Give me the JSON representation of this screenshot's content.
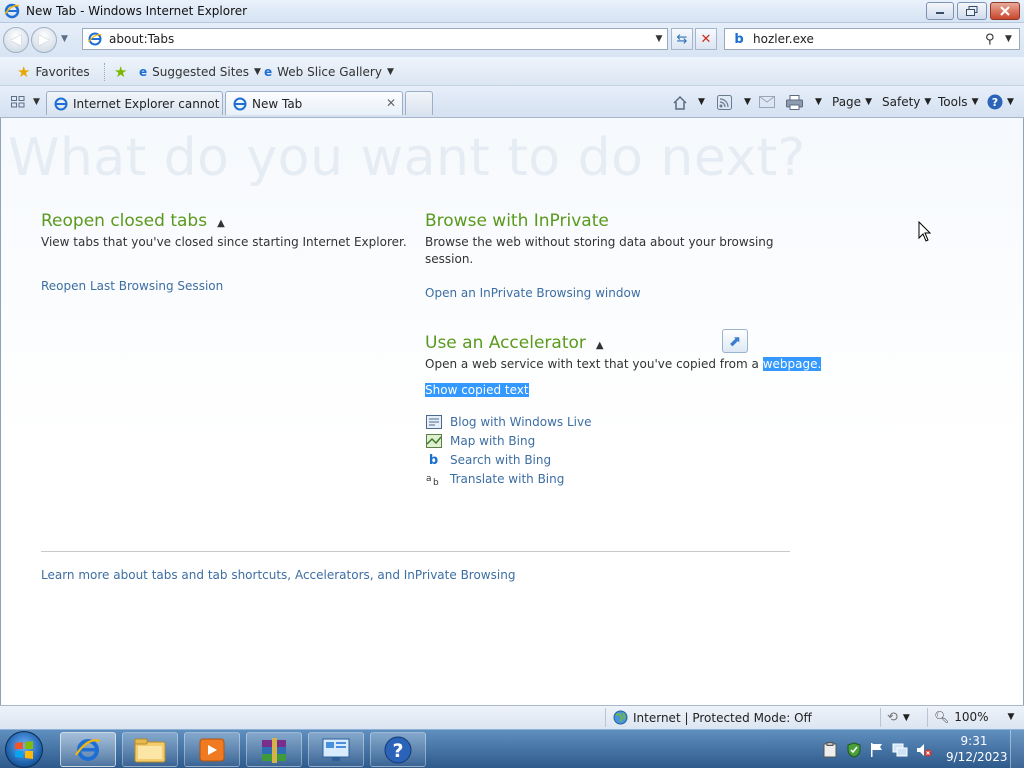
{
  "window": {
    "title": "New Tab - Windows Internet Explorer"
  },
  "address_bar": {
    "url": "about:Tabs"
  },
  "search_box": {
    "value": "hozler.exe"
  },
  "favorites_bar": {
    "favorites_label": "Favorites",
    "suggested_sites_label": "Suggested Sites",
    "web_slice_gallery_label": "Web Slice Gallery"
  },
  "tabs": [
    {
      "label": "Internet Explorer cannot di...",
      "active": false
    },
    {
      "label": "New Tab",
      "active": true
    }
  ],
  "command_bar": {
    "page_label": "Page",
    "safety_label": "Safety",
    "tools_label": "Tools"
  },
  "content": {
    "heading": "What do you want to do next?",
    "reopen": {
      "title": "Reopen closed tabs",
      "description": "View tabs that you've closed since starting Internet Explorer.",
      "link": "Reopen Last Browsing Session"
    },
    "inprivate": {
      "title": "Browse with InPrivate",
      "description_line1": "Browse the web without storing data about your browsing",
      "description_line2": "session.",
      "link": "Open an InPrivate Browsing window"
    },
    "accelerator": {
      "title": "Use an Accelerator",
      "description": "Open a web service with text that you've copied from a",
      "highlighted_word": "webpage.",
      "show_copied_text": "Show copied text",
      "items": [
        {
          "label": "Blog with Windows Live",
          "icon": "windows-live-icon"
        },
        {
          "label": "Map with Bing",
          "icon": "map-icon"
        },
        {
          "label": "Search with Bing",
          "icon": "bing-icon"
        },
        {
          "label": "Translate with Bing",
          "icon": "translate-icon"
        }
      ]
    },
    "learn_more": "Learn more about tabs and tab shortcuts, Accelerators, and InPrivate Browsing"
  },
  "status_bar": {
    "zone": "Internet | Protected Mode: Off",
    "zoom": "100%"
  },
  "taskbar": {
    "time": "9:31",
    "date": "9/12/2023"
  },
  "colors": {
    "section_heading": "#5a9a1c",
    "link": "#3d6ea3",
    "selection": "#3399ff",
    "taskbar": "#2e5a8c"
  }
}
